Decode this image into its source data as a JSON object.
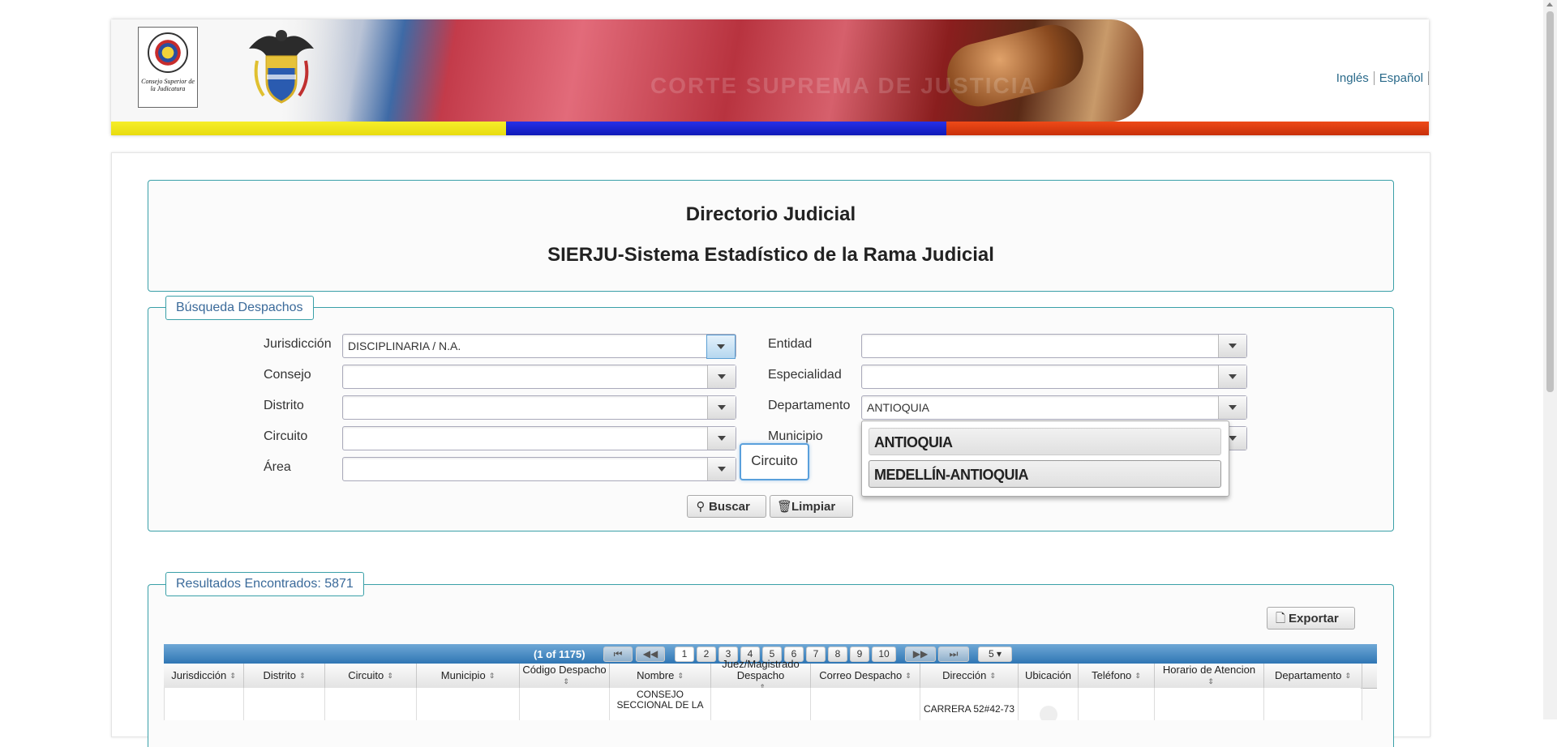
{
  "header": {
    "seal_text": "Consejo Superior de la Judicatura",
    "seal_ring_text": "Rama Judicial · República de Colombia",
    "banner_watermark": "CORTE SUPREMA DE JUSTICIA",
    "lang_links": [
      "Inglés",
      "Español"
    ]
  },
  "title": {
    "line1": "Directorio Judicial",
    "line2": "SIERJU-Sistema Estadístico de la Rama Judicial"
  },
  "search": {
    "legend": "Búsqueda Despachos",
    "fields": {
      "jurisdiccion": {
        "label": "Jurisdicción",
        "value": "DISCIPLINARIA / N.A."
      },
      "consejo": {
        "label": "Consejo",
        "value": ""
      },
      "distrito": {
        "label": "Distrito",
        "value": ""
      },
      "circuito": {
        "label": "Circuito",
        "value": ""
      },
      "area": {
        "label": "Área",
        "value": ""
      },
      "entidad": {
        "label": "Entidad",
        "value": ""
      },
      "especialidad": {
        "label": "Especialidad",
        "value": ""
      },
      "departamento": {
        "label": "Departamento",
        "value": "ANTIOQUIA"
      },
      "municipio": {
        "label": "Municipio",
        "value": ""
      }
    },
    "tooltip": "Circuito",
    "dropdown_options": [
      "ANTIOQUIA",
      "MEDELLÍN-ANTIOQUIA"
    ],
    "buscar_label": "Buscar",
    "limpiar_label": "Limpiar"
  },
  "results": {
    "legend": "Resultados Encontrados: 5871",
    "export_label": "Exportar",
    "page_info": "(1 of 1175)",
    "pages": [
      "1",
      "2",
      "3",
      "4",
      "5",
      "6",
      "7",
      "8",
      "9",
      "10"
    ],
    "rows_per_page": "5",
    "columns": [
      "Jurisdicción",
      "Distrito",
      "Circuito",
      "Municipio",
      "Código Despacho",
      "Nombre",
      "Juez/Magistrado Despacho",
      "Correo Despacho",
      "Dirección",
      "Ubicación",
      "Teléfono",
      "Horario de Atencion",
      "Departamento"
    ],
    "first_row": {
      "nombre": "CONSEJO SECCIONAL DE LA",
      "direccion": "CARRERA 52#42-73"
    }
  },
  "colors": {
    "accent_teal": "#3aa0a8",
    "grid_header_blue": "#2f76b4",
    "link": "#2a6a8a",
    "flag_yellow": "#f6ee2a",
    "flag_blue": "#1a24d0",
    "flag_red": "#e23e12"
  }
}
